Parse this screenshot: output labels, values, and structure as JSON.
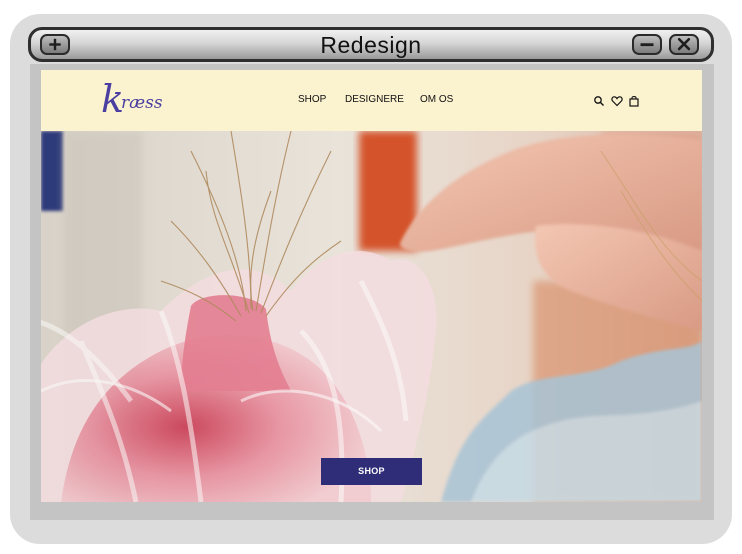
{
  "window": {
    "title": "Redesign",
    "buttons": [
      "add-icon",
      "minimize-icon",
      "close-icon"
    ]
  },
  "site": {
    "logo": {
      "initial": "k",
      "rest": "ræss",
      "color": "#4a3fa0"
    },
    "nav": [
      {
        "label": "SHOP"
      },
      {
        "label": "DESIGNERE"
      },
      {
        "label": "OM OS"
      }
    ],
    "header_icons": [
      "search-icon",
      "heart-icon",
      "bag-icon"
    ],
    "header_background": "#fbf2d0",
    "hero": {
      "cta_label": "SHOP",
      "cta_color": "#2f2d77"
    }
  }
}
